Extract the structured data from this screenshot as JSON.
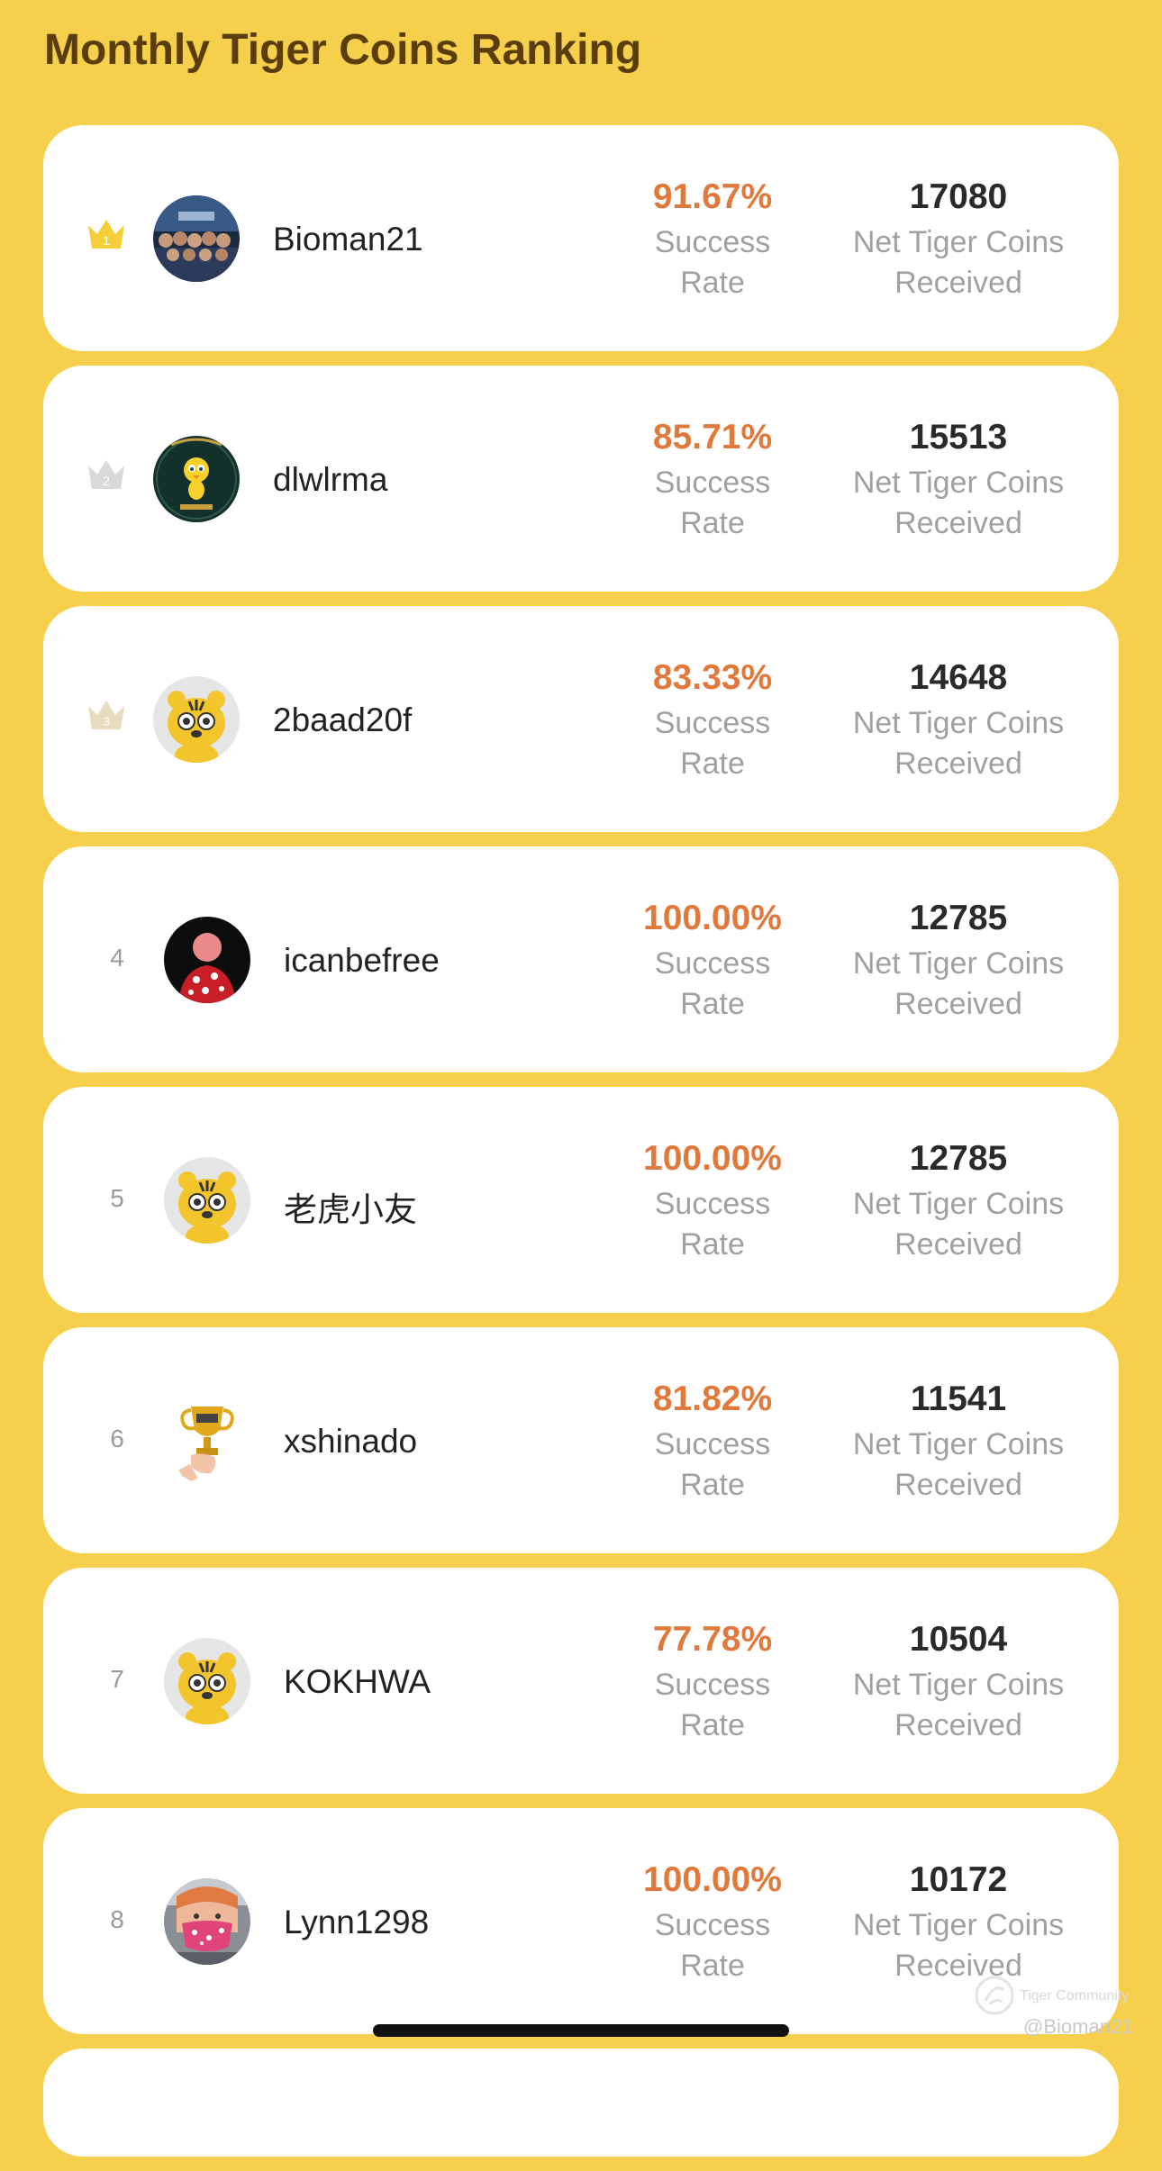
{
  "header": {
    "title": "Monthly Tiger Coins Ranking"
  },
  "labels": {
    "success_line1": "Success",
    "success_line2": "Rate",
    "coins_line1": "Net Tiger Coins",
    "coins_line2": "Received"
  },
  "colors": {
    "background": "#f6d04d",
    "card": "#ffffff",
    "title": "#5a3d0c",
    "rate": "#e07a3c",
    "gold_crown": "#f5cf3a",
    "silver_crown": "#d9d9d9",
    "bronze_crown": "#e8dcc0"
  },
  "rankings": [
    {
      "rank": "1",
      "badge": "gold-crown-icon",
      "avatar": "group-photo-avatar",
      "username": "Bioman21",
      "success_rate": "91.67%",
      "net_coins": "17080"
    },
    {
      "rank": "2",
      "badge": "silver-crown-icon",
      "avatar": "tweety-avatar",
      "username": "dlwlrma",
      "success_rate": "85.71%",
      "net_coins": "15513"
    },
    {
      "rank": "3",
      "badge": "bronze-crown-icon",
      "avatar": "tiger-avatar",
      "username": "2baad20f",
      "success_rate": "83.33%",
      "net_coins": "14648"
    },
    {
      "rank": "4",
      "badge": null,
      "avatar": "hawaiian-shirt-avatar",
      "username": "icanbefree",
      "success_rate": "100.00%",
      "net_coins": "12785"
    },
    {
      "rank": "5",
      "badge": null,
      "avatar": "tiger-avatar",
      "username": "老虎小友",
      "success_rate": "100.00%",
      "net_coins": "12785"
    },
    {
      "rank": "6",
      "badge": null,
      "avatar": "trophy-avatar",
      "username": "xshinado",
      "success_rate": "81.82%",
      "net_coins": "11541"
    },
    {
      "rank": "7",
      "badge": null,
      "avatar": "tiger-avatar",
      "username": "KOKHWA",
      "success_rate": "77.78%",
      "net_coins": "10504"
    },
    {
      "rank": "8",
      "badge": null,
      "avatar": "masked-person-avatar",
      "username": "Lynn1298",
      "success_rate": "100.00%",
      "net_coins": "10172"
    }
  ],
  "watermark": {
    "brand": "Tiger Community",
    "handle": "@Bioman21"
  }
}
